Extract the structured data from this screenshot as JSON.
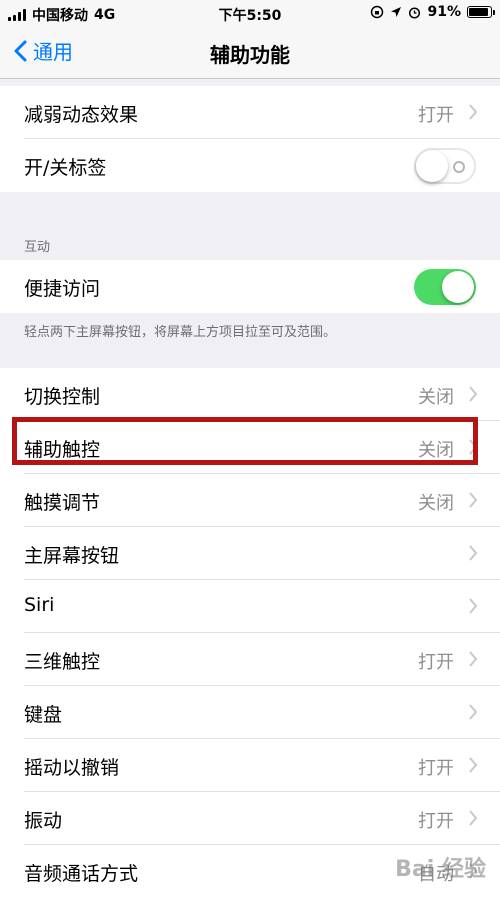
{
  "status_bar": {
    "carrier": "中国移动",
    "network": "4G",
    "time": "下午5:50",
    "battery": "91%",
    "battery_level": 0.91
  },
  "nav": {
    "back_label": "通用",
    "title": "辅助功能"
  },
  "group1": {
    "reduce_motion": {
      "label": "减弱动态效果",
      "value": "打开"
    },
    "onoff_labels": {
      "label": "开/关标签",
      "toggle": "off"
    }
  },
  "interaction": {
    "header": "互动",
    "reachability": {
      "label": "便捷访问",
      "toggle": "on"
    },
    "note": "轻点两下主屏幕按钮，将屏幕上方项目拉至可及范围。"
  },
  "group3": {
    "rows": [
      {
        "label": "切换控制",
        "value": "关闭"
      },
      {
        "label": "辅助触控",
        "value": "关闭"
      },
      {
        "label": "触摸调节",
        "value": "关闭"
      },
      {
        "label": "主屏幕按钮",
        "value": ""
      },
      {
        "label": "Siri",
        "value": ""
      },
      {
        "label": "三维触控",
        "value": "打开"
      },
      {
        "label": "键盘",
        "value": ""
      },
      {
        "label": "摇动以撤销",
        "value": "打开"
      },
      {
        "label": "振动",
        "value": "打开"
      },
      {
        "label": "音频通话方式",
        "value": "自动"
      }
    ]
  },
  "watermark": "Bai 经验",
  "colors": {
    "accent": "#007aff",
    "toggle_on": "#4cd964",
    "highlight": "#b31414"
  }
}
